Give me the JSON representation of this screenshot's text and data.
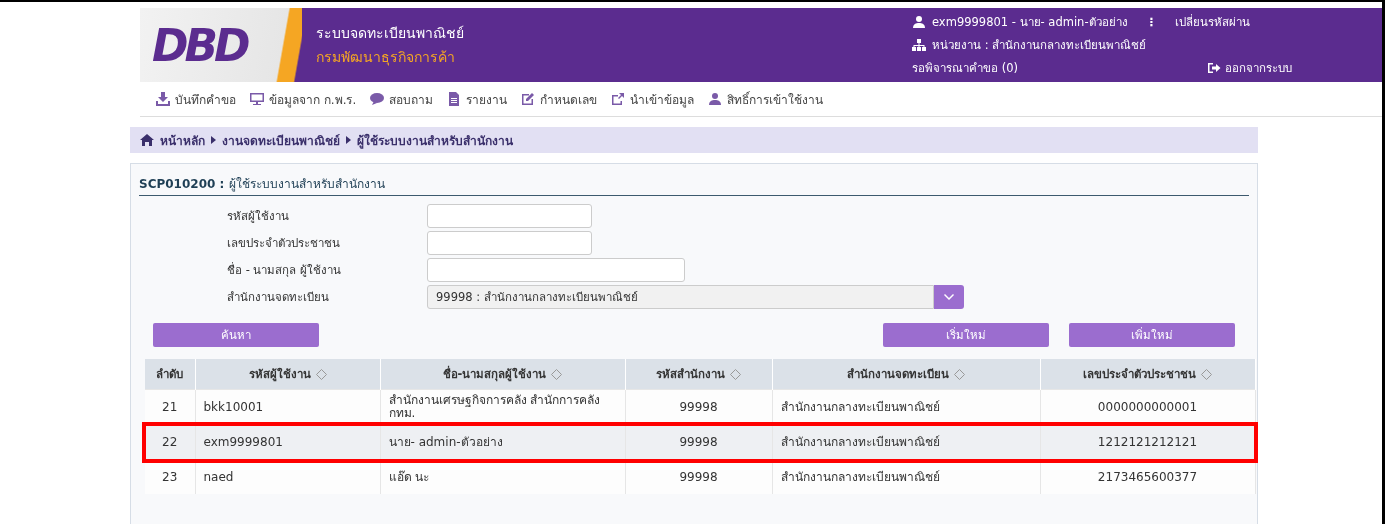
{
  "header": {
    "logo": "DBD",
    "title": "ระบบจดทะเบียนพาณิชย์",
    "subtitle": "กรมพัฒนาธุรกิจการค้า",
    "user": "exm9999801 - นาย- admin-ตัวอย่าง",
    "separator": "⋮",
    "change_password": "เปลี่ยนรหัสผ่าน",
    "unit": "หน่วยงาน : สำนักงานกลางทะเบียนพาณิชย์",
    "pending": "รอพิจารณาคำขอ (0)",
    "logout": "ออกจากระบบ"
  },
  "nav": [
    {
      "label": "บันทึกคำขอ",
      "kind": "download"
    },
    {
      "label": "ข้อมูลจาก ก.พ.ร.",
      "kind": "monitor"
    },
    {
      "label": "สอบถาม",
      "kind": "chat"
    },
    {
      "label": "รายงาน",
      "kind": "document"
    },
    {
      "label": "กำหนดเลข",
      "kind": "edit"
    },
    {
      "label": "นำเข้าข้อมูล",
      "kind": "share"
    },
    {
      "label": "สิทธิ์การเข้าใช้งาน",
      "kind": "user"
    }
  ],
  "breadcrumb": [
    "หน้าหลัก",
    "งานจดทะเบียนพาณิชย์",
    "ผู้ใช้ระบบงานสำหรับสำนักงาน"
  ],
  "panel": {
    "code": "SCP010200 :",
    "title": "ผู้ใช้ระบบงานสำหรับสำนักงาน"
  },
  "form": [
    {
      "label": "รหัสผู้ใช้งาน",
      "kind": "text"
    },
    {
      "label": "เลขประจำตัวประชาชน",
      "kind": "text"
    },
    {
      "label": "ชื่อ - นามสกุล ผู้ใช้งาน",
      "kind": "wide"
    },
    {
      "label": "สำนักงานจดทะเบียน",
      "kind": "select",
      "value": "99998 : สำนักงานกลางทะเบียนพาณิชย์"
    }
  ],
  "buttons": {
    "search": "ค้นหา",
    "reset": "เริ่มใหม่",
    "add": "เพิ่มใหม่"
  },
  "table": {
    "columns": [
      {
        "label": "ลำดับ",
        "sortable": false
      },
      {
        "label": "รหัสผู้ใช้งาน",
        "sortable": true
      },
      {
        "label": "ชื่อ-นามสกุลผู้ใช้งาน",
        "sortable": true
      },
      {
        "label": "รหัสสำนักงาน",
        "sortable": true
      },
      {
        "label": "สำนักงานจดทะเบียน",
        "sortable": true
      },
      {
        "label": "เลขประจำตัวประชาชน",
        "sortable": true
      }
    ],
    "rows": [
      {
        "cells": [
          "21",
          "bkk10001",
          "สำนักงานเศรษฐกิจการคลัง สำนักการคลัง กทม.",
          "99998",
          "สำนักงานกลางทะเบียนพาณิชย์",
          "0000000000001"
        ],
        "highlighted": false
      },
      {
        "cells": [
          "22",
          "exm9999801",
          "นาย- admin-ตัวอย่าง",
          "99998",
          "สำนักงานกลางทะเบียนพาณิชย์",
          "1212121212121"
        ],
        "highlighted": true
      },
      {
        "cells": [
          "23",
          "naed",
          "แอ๊ด นะ",
          "99998",
          "สำนักงานกลางทะเบียนพาณิชย์",
          "2173465600377"
        ],
        "highlighted": false
      }
    ]
  }
}
